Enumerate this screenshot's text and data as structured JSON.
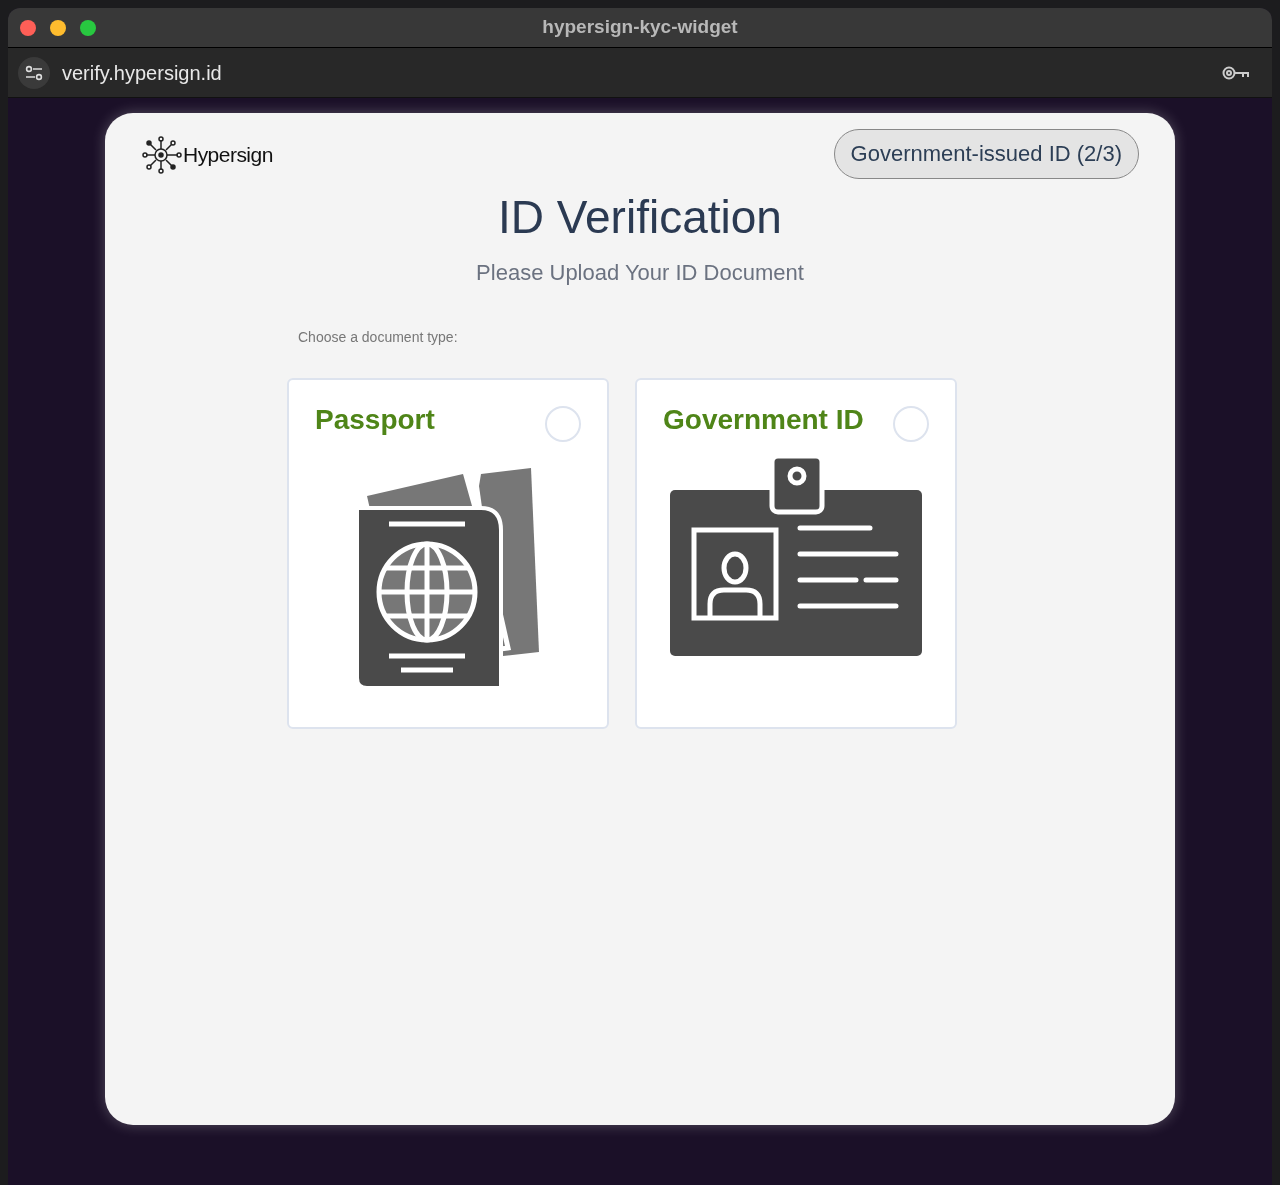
{
  "window": {
    "title": "hypersign-kyc-widget",
    "url": "verify.hypersign.id"
  },
  "header": {
    "logo_text": "Hypersign",
    "step_badge": "Government-issued ID (2/3)"
  },
  "title": "ID Verification",
  "subtitle": "Please Upload Your ID Document",
  "prompt": "Choose a document type:",
  "options": [
    {
      "kind": "passport",
      "label": "Passport",
      "selected": false
    },
    {
      "kind": "government-id",
      "label": "Government ID",
      "selected": false
    }
  ]
}
